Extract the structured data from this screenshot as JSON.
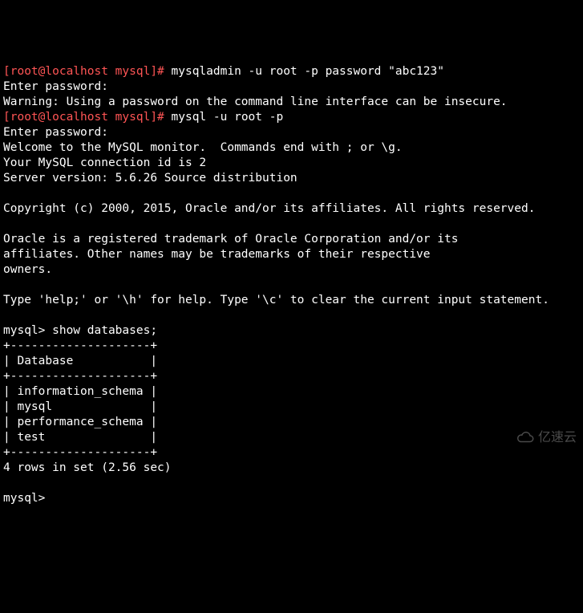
{
  "shell": {
    "prompt_user": "[root@localhost mysql]# ",
    "cmd1": "mysqladmin -u root -p password \"abc123\"",
    "enter_pw": "Enter password:",
    "warn": "Warning: Using a password on the command line interface can be insecure.",
    "cmd2": "mysql -u root -p"
  },
  "mysql": {
    "welcome": "Welcome to the MySQL monitor.  Commands end with ; or \\g.",
    "conn_id": "Your MySQL connection id is 2",
    "server_ver": "Server version: 5.6.26 Source distribution",
    "copyright": "Copyright (c) 2000, 2015, Oracle and/or its affiliates. All rights reserved.",
    "oracle1": "Oracle is a registered trademark of Oracle Corporation and/or its",
    "oracle2": "affiliates. Other names may be trademarks of their respective",
    "oracle3": "owners.",
    "help": "Type 'help;' or '\\h' for help. Type '\\c' to clear the current input statement.",
    "prompt": "mysql> ",
    "q1": "show databases;",
    "tbl_border": "+--------------------+",
    "tbl_header": "| Database           |",
    "rows": [
      "| information_schema |",
      "| mysql              |",
      "| performance_schema |",
      "| test               |"
    ],
    "result_msg": "4 rows in set (2.56 sec)"
  },
  "watermark": "亿速云"
}
